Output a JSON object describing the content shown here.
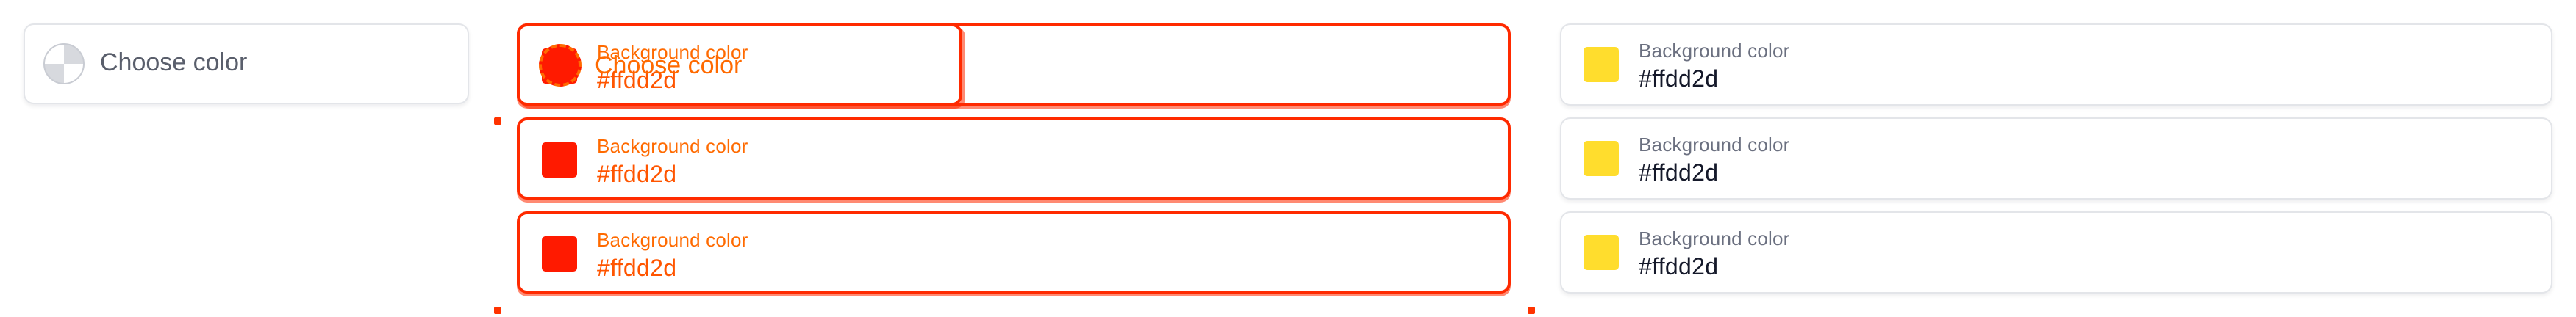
{
  "colors": {
    "yellow_swatch": "#ffdd2d",
    "red_swatch": "#ff1a00",
    "highlight_border": "#ff2a00",
    "neutral_border": "#e3e5e9"
  },
  "column_empty": {
    "picker": {
      "icon": "transparent-checker-icon",
      "placeholder": "Choose color"
    }
  },
  "column_highlighted": {
    "overlay_picker": {
      "icon": "red-circle-swatch-icon",
      "placeholder": "Choose color"
    },
    "pickers": [
      {
        "label": "Background color",
        "value": "#ffdd2d"
      },
      {
        "label": "Background color",
        "value": "#ffdd2d"
      },
      {
        "label": "Background color",
        "value": "#ffdd2d"
      }
    ]
  },
  "column_filled": {
    "pickers": [
      {
        "label": "Background color",
        "value": "#ffdd2d"
      },
      {
        "label": "Background color",
        "value": "#ffdd2d"
      },
      {
        "label": "Background color",
        "value": "#ffdd2d"
      }
    ]
  }
}
